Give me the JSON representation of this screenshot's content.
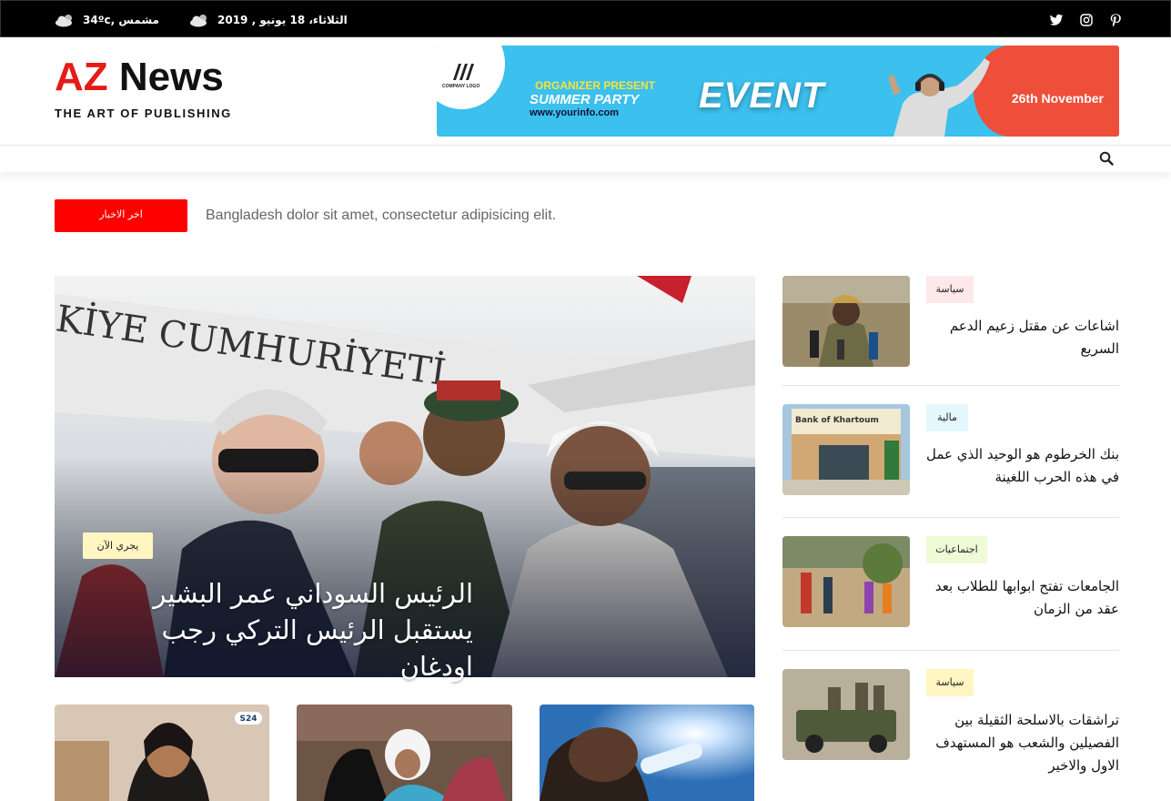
{
  "topbar": {
    "weather_temp": "34ºc, مشمس",
    "weather_date": "الثلاثاء، 18 يونيو , 2019",
    "social_icons": [
      "twitter-icon",
      "instagram-icon",
      "pinterest-icon"
    ]
  },
  "header": {
    "logo_az": "AZ",
    "logo_news": "News",
    "logo_tagline": "THE ART OF PUBLISHING",
    "banner": {
      "company_logo": "COMPANY LOGO",
      "organizer": "ORGANIZER PRESENT",
      "party": "SUMMER PARTY",
      "url": "www.yourinfo.com",
      "event": "EVENT",
      "date": "26th November"
    }
  },
  "ticker": {
    "label": "اخر الاخبار",
    "text": "Bangladesh dolor sit amet, consectetur adipisicing elit."
  },
  "hero": {
    "badge": "يجري الآن",
    "title": "الرئيس السوداني عمر البشير يستقبل الرئيس التركي رجب اودغان"
  },
  "side_posts": [
    {
      "badge": "سياسة",
      "title": "اشاعات عن مقتل زعيم الدعم السريع"
    },
    {
      "badge": "مالية",
      "title": "بنك الخرطوم هو الوحيد الذي عمل في هذه الحرب اللغينة"
    },
    {
      "badge": "اجتماعيات",
      "title": "الجامعات تفتح ابوابها للطلاب بعد عقد من الزمان"
    },
    {
      "badge": "سياسة",
      "title": "تراشقات بالاسلحة الثقيلة بين الفصيلين والشعب هو المستهدف الاول والاخير"
    }
  ],
  "colors": {
    "accent_red": "#ff0000",
    "badge_politics": "#fde8ea",
    "badge_finance": "#e4f7fd",
    "badge_social": "#effad7",
    "badge_politics_2": "#fff6c2"
  }
}
